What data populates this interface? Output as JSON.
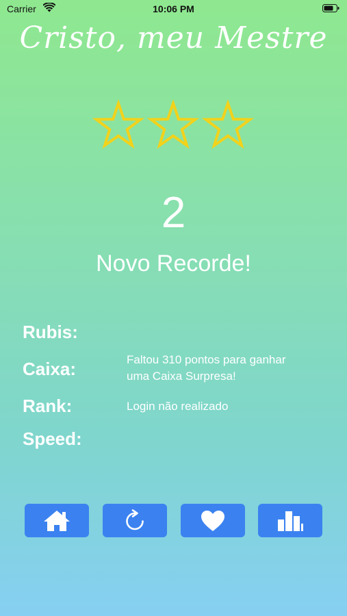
{
  "status_bar": {
    "carrier": "Carrier",
    "time": "10:06 PM",
    "icons": [
      "wifi-icon",
      "battery-icon"
    ]
  },
  "header": {
    "title": "Cristo, meu Mestre"
  },
  "result": {
    "stars_total": 3,
    "stars_filled": 0,
    "star_color": "#f2d21b",
    "score": "2",
    "message": "Novo Recorde!"
  },
  "stats": {
    "rubis_label": "Rubis:",
    "rubis_value": "",
    "caixa_label": "Caixa:",
    "caixa_value_line1": "Faltou 310 pontos para ganhar",
    "caixa_value_line2": "uma Caixa Surpresa!",
    "rank_label": "Rank:",
    "rank_value": "Login não realizado",
    "speed_label": "Speed:",
    "speed_value": ""
  },
  "buttons": {
    "color": "#3b82f0",
    "items": [
      "home-icon",
      "refresh-icon",
      "heart-icon",
      "bar-chart-icon"
    ]
  }
}
